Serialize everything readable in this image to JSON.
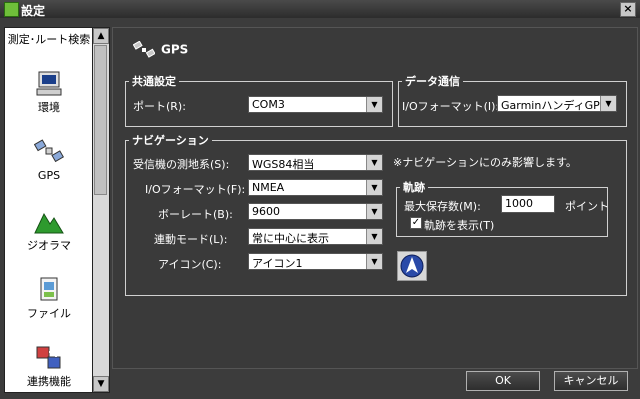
{
  "window": {
    "title": "設定",
    "close_glyph": "×"
  },
  "sidebar": {
    "items": [
      {
        "label": "測定･ルート検索",
        "icon": "route-search-icon"
      },
      {
        "label": "環境",
        "icon": "computer-icon"
      },
      {
        "label": "GPS",
        "icon": "satellite-icon"
      },
      {
        "label": "ジオラマ",
        "icon": "mountain-icon"
      },
      {
        "label": "ファイル",
        "icon": "file-icon"
      },
      {
        "label": "連携機能",
        "icon": "link-icon"
      }
    ],
    "scroll_up": "▲",
    "scroll_down": "▼"
  },
  "page": {
    "title": "GPS"
  },
  "common": {
    "legend": "共通設定",
    "port_label": "ポート(R):",
    "port_value": "COM3"
  },
  "data_comm": {
    "legend": "データ通信",
    "io_label": "I/Oフォーマット(I):",
    "io_value": "GarminハンディGPS"
  },
  "navigation": {
    "legend": "ナビゲーション",
    "note": "※ナビゲーションにのみ影響します。",
    "rows": [
      {
        "label": "受信機の測地系(S):",
        "value": "WGS84相当"
      },
      {
        "label": "I/Oフォーマット(F):",
        "value": "NMEA"
      },
      {
        "label": "ボーレート(B):",
        "value": "9600"
      },
      {
        "label": "連動モード(L):",
        "value": "常に中心に表示"
      },
      {
        "label": "アイコン(C):",
        "value": "アイコン1"
      }
    ],
    "track": {
      "legend": "軌跡",
      "max_label": "最大保存数(M):",
      "max_value": "1000",
      "unit": "ポイント",
      "show_label": "軌跡を表示(T)",
      "show_checked": "✓"
    }
  },
  "dropdown_glyph": "▼",
  "buttons": {
    "ok": "OK",
    "cancel": "キャンセル"
  },
  "colors": {
    "background": "#3a3a3a",
    "sidebar": "#ffffff",
    "selected": "#0a246a"
  }
}
